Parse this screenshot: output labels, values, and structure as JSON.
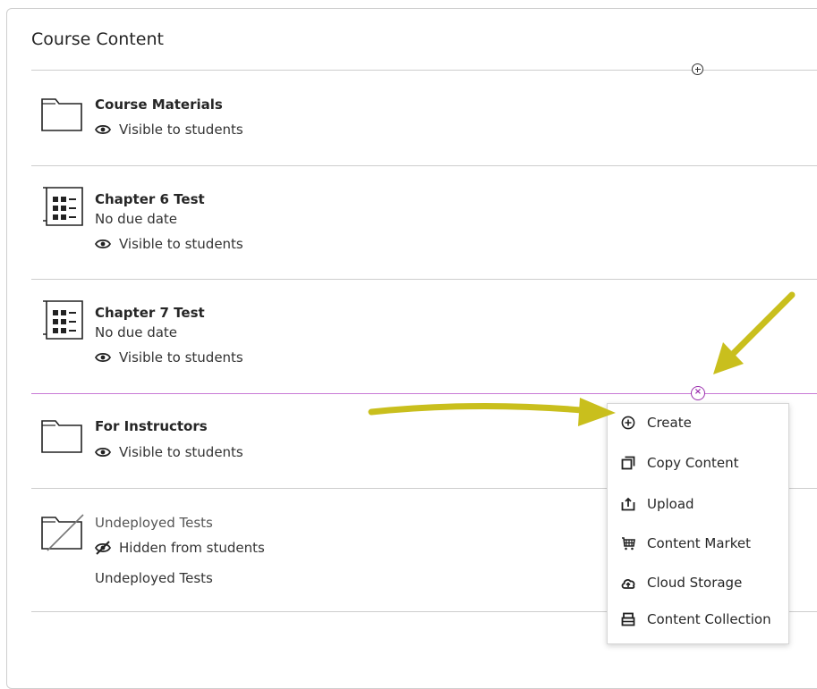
{
  "page": {
    "title": "Course Content"
  },
  "items": [
    {
      "name": "Course Materials",
      "visibility": "Visible to students"
    },
    {
      "name": "Chapter 6 Test",
      "due": "No due date",
      "visibility": "Visible to students"
    },
    {
      "name": "Chapter 7 Test",
      "due": "No due date",
      "visibility": "Visible to students"
    },
    {
      "name": "For Instructors",
      "visibility": "Visible to students"
    },
    {
      "name": "Undeployed Tests",
      "visibility": "Hidden from students",
      "description": "Undeployed Tests"
    }
  ],
  "menu": {
    "items": [
      {
        "label": "Create",
        "icon": "plus-circle-icon"
      },
      {
        "label": "Copy Content",
        "icon": "copy-icon"
      },
      {
        "label": "Upload",
        "icon": "upload-icon"
      },
      {
        "label": "Content Market",
        "icon": "cart-icon"
      },
      {
        "label": "Cloud Storage",
        "icon": "cloud-upload-icon"
      },
      {
        "label": "Content Collection",
        "icon": "collection-icon"
      }
    ]
  },
  "colors": {
    "accent": "#9b2fae",
    "annotation_arrow": "#c9bf1d"
  }
}
